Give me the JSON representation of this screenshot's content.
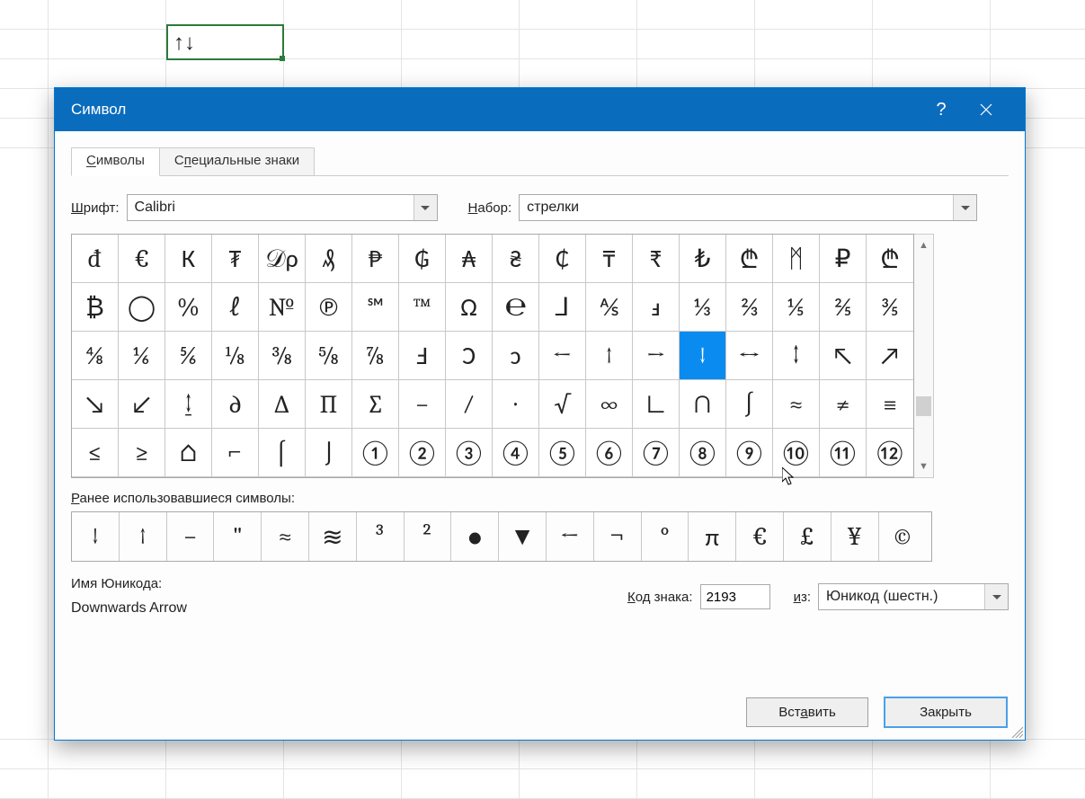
{
  "spreadsheet": {
    "active_cell_value": "↑↓"
  },
  "dialog": {
    "title": "Символ",
    "tabs": {
      "symbols": "Символы",
      "special": "Специальные знаки"
    },
    "font_label": "Шрифт:",
    "font_value": "Calibri",
    "set_label": "Набор:",
    "set_value": "стрелки",
    "recent_label": "Ранее использовавшиеся символы:",
    "unicode_name_label": "Имя Юникода:",
    "unicode_name_value": "Downwards Arrow",
    "code_label": "Код знака:",
    "code_value": "2193",
    "from_label": "из:",
    "from_value": "Юникод (шестн.)",
    "insert_button": "Вставить",
    "close_button": "Закрыть"
  },
  "symbols_grid": [
    "đ",
    "€",
    "К",
    "₮",
    "𝒟ρ",
    "₰",
    "₱",
    "₲",
    "₳",
    "₴",
    "₵",
    "₸",
    "₹",
    "₺",
    "₾",
    "ᛗ",
    "₽",
    "₾",
    "₿",
    "◯",
    "%",
    "ℓ",
    "№",
    "℗",
    "℠",
    "™",
    "Ω",
    "℮",
    "⅃",
    "⅍",
    "ⅎ",
    "⅓",
    "⅔",
    "⅕",
    "⅖",
    "⅗",
    "⅘",
    "⅙",
    "⅚",
    "⅛",
    "⅜",
    "⅝",
    "⅞",
    "Ⅎ",
    "Ↄ",
    "ↄ",
    "←",
    "↑",
    "→",
    "↓",
    "↔",
    "↕",
    "↖",
    "↗",
    "↘",
    "↙",
    "↨",
    "∂",
    "∆",
    "∏",
    "∑",
    "−",
    "∕",
    "∙",
    "√",
    "∞",
    "∟",
    "∩",
    "∫",
    "≈",
    "≠",
    "≡",
    "≤",
    "≥",
    "⌂",
    "⌐",
    "⌠",
    "⌡",
    "①",
    "②",
    "③",
    "④",
    "⑤",
    "⑥",
    "⑦",
    "⑧",
    "⑨",
    "⑩",
    "⑪",
    "⑫"
  ],
  "selected_symbol_index": 49,
  "recent_symbols": [
    "↓",
    "↑",
    "−",
    "\"",
    "≈",
    "≋",
    "³",
    "²",
    "●",
    "▼",
    "←",
    "¬",
    "°",
    "π",
    "€",
    "£",
    "¥",
    "©"
  ]
}
